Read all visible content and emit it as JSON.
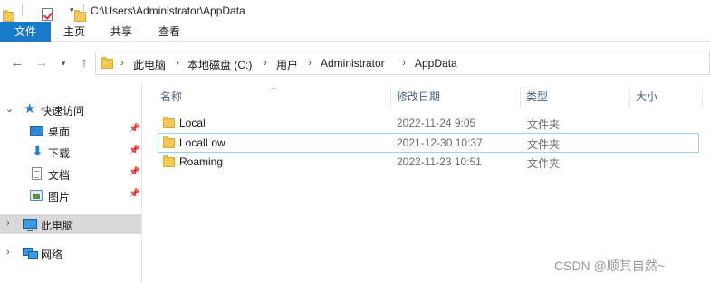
{
  "window": {
    "title": "C:\\Users\\Administrator\\AppData"
  },
  "ribbon": {
    "tabs": [
      {
        "label": "文件"
      },
      {
        "label": "主页"
      },
      {
        "label": "共享"
      },
      {
        "label": "查看"
      }
    ]
  },
  "nav": {
    "back_icon": "arrow-left-icon",
    "forward_icon": "arrow-right-icon",
    "recent_icon": "chevron-down-icon",
    "up_icon": "arrow-up-icon",
    "breadcrumb": [
      "此电脑",
      "本地磁盘 (C:)",
      "用户",
      "Administrator",
      "AppData"
    ]
  },
  "sidebar": {
    "quick_access": "快速访问",
    "items": [
      {
        "label": "桌面",
        "icon": "desktop-icon",
        "pinned": true
      },
      {
        "label": "下载",
        "icon": "download-icon",
        "pinned": true
      },
      {
        "label": "文档",
        "icon": "document-icon",
        "pinned": true
      },
      {
        "label": "图片",
        "icon": "pictures-icon",
        "pinned": true
      }
    ],
    "this_pc": "此电脑",
    "network": "网络"
  },
  "columns": {
    "name": "名称",
    "modified": "修改日期",
    "type": "类型",
    "size": "大小"
  },
  "files": [
    {
      "name": "Local",
      "modified": "2022-11-24 9:05",
      "type": "文件夹"
    },
    {
      "name": "LocalLow",
      "modified": "2021-12-30 10:37",
      "type": "文件夹"
    },
    {
      "name": "Roaming",
      "modified": "2022-11-23 10:51",
      "type": "文件夹"
    }
  ],
  "watermark": "CSDN @顺其自然~",
  "colors": {
    "accent": "#1979ca",
    "selection_border": "#99d1ff",
    "folder": "#f0c958"
  }
}
